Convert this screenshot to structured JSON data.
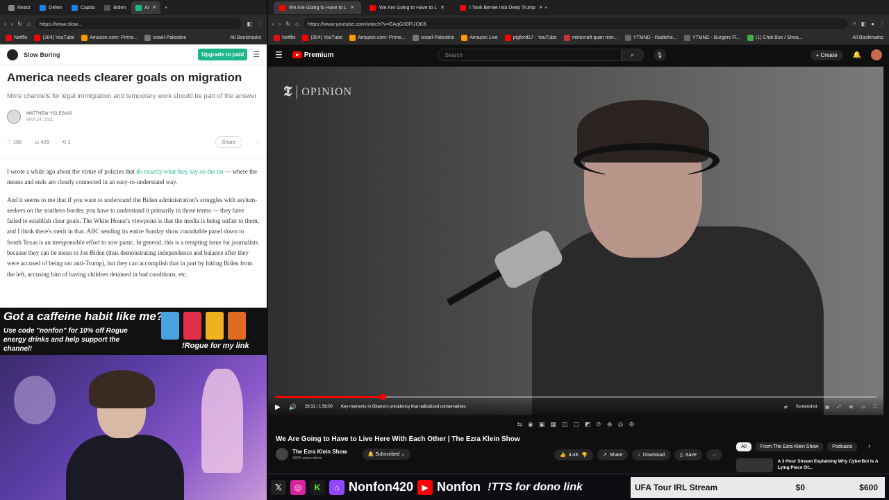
{
  "left_browser": {
    "tabs": [
      "React",
      "Defen",
      "Capita",
      "Biden",
      "Ar"
    ],
    "url": "https://www.slow...",
    "bookmarks": [
      "Netflix",
      "(304) YouTube",
      "Amazon.com: Prime...",
      "Israel-Palestine",
      "All Bookmarks"
    ]
  },
  "article": {
    "pub_name": "Slow Boring",
    "upgrade_label": "Upgrade to paid",
    "title": "America needs clearer goals on migration",
    "subtitle": "More channels for legal immigration and temporary work should be part of the answer",
    "author": "MATTHEW YGLESIAS",
    "date": "MAR 24, 2021",
    "likes": "109",
    "comments": "428",
    "restacks": "1",
    "share_label": "Share",
    "p1_a": "I wrote a while ago about the virtue of policies that ",
    "p1_link": "do exactly what they say on the tin",
    "p1_b": " — where the means and ends are clearly connected in an easy-to-understand way.",
    "p2": "And it seems to me that if you want to understand the Biden administration's struggles with asylum-seekers on the southern border, you have to understand it primarily in those terms — they have failed to establish clear goals. The White House's viewpoint is that the media is being unfair to them, and I think there's merit in that. ABC sending its entire Sunday show roundtable panel down to South Texas is an irresponsible effort to sow panic. In general, this is a tempting issue for journalists because they can be mean to Joe Biden (thus demonstrating independence and balance after they were accused of being too anti-Trump), but they can accomplish that in part by hitting Biden from the left, accusing him of having children detained in bad conditions, etc."
  },
  "ad": {
    "headline": "Got a caffeine habit like me?",
    "body": "Use code \"nonfon\" for 10% off Rogue energy drinks and help support the channel!",
    "cta": "!Rogue for my link"
  },
  "right_browser": {
    "tabs": [
      "We Are Going to Have to L",
      "We Are Going to Have to L",
      "I Took Bernie Into Deep Trump"
    ],
    "url": "https://www.youtube.com/watch?v=EAqG00FUOK8",
    "bookmarks": [
      "Netflix",
      "(304) YouTube",
      "Amazon.com: Prime...",
      "Israel-Palestine",
      "Amazon Live",
      "pigford17 - YouTube",
      "minecraft quan tron...",
      "YTMND - Radiohe...",
      "YTMND - Burgers Fl...",
      "(1) Chat Box / Strea...",
      "All Bookmarks"
    ]
  },
  "youtube": {
    "logo_text": "Premium",
    "search_placeholder": "Search",
    "create_label": "Create",
    "watermark": "OPINION",
    "progress_fraction": 0.18,
    "time": "28:31 / 1:58:00",
    "chapter": "Key moments in Obama's presidency that radicalized conservatives",
    "screenshot_label": "Screenshot",
    "title": "We Are Going to Have to Live Here With Each Other | The Ezra Klein Show",
    "channel": "The Ezra Klein Show",
    "subs": "422K subscribers",
    "subscribed_label": "Subscribed",
    "likes": "4.4K",
    "share": "Share",
    "download": "Download",
    "save": "Save",
    "chips": [
      "All",
      "From The Ezra Klein Show",
      "Podcasts"
    ],
    "rec_title": "A 3 Hour Stream Explaining Why CyberBoi Is A Lying Piece Of..."
  },
  "stream_bar": {
    "handle1": "Nonfon420",
    "handle2": "Nonfon",
    "tts": "!TTS for dono link",
    "goal_name": "UFA Tour IRL Stream",
    "goal_current": "$0",
    "goal_target": "$600"
  }
}
